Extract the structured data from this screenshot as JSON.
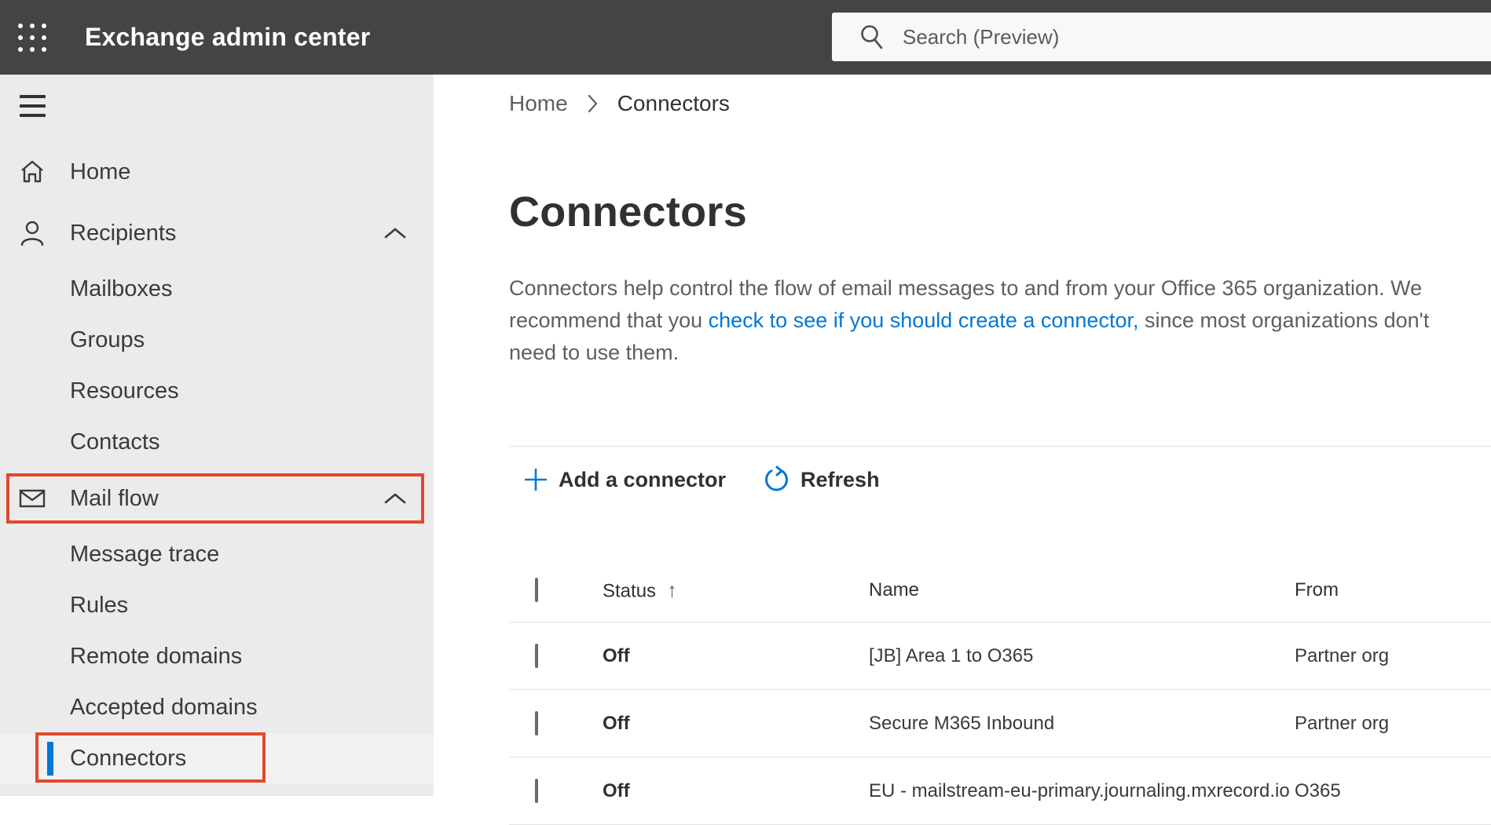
{
  "topbar": {
    "title": "Exchange admin center",
    "search_placeholder": "Search (Preview)",
    "icons": {
      "app_launcher": "waffle-icon",
      "search": "magnifier-icon"
    }
  },
  "sidebar": {
    "hamburger_icon": "hamburger-menu-icon",
    "items": [
      {
        "label": "Home",
        "icon": "home-icon",
        "level": 1
      },
      {
        "label": "Recipients",
        "icon": "person-icon",
        "level": 1,
        "expanded": true
      },
      {
        "label": "Mailboxes",
        "level": 2
      },
      {
        "label": "Groups",
        "level": 2
      },
      {
        "label": "Resources",
        "level": 2
      },
      {
        "label": "Contacts",
        "level": 2
      },
      {
        "label": "Mail flow",
        "icon": "mail-envelope-icon",
        "level": 1,
        "expanded": true,
        "annotated": true
      },
      {
        "label": "Message trace",
        "level": 2
      },
      {
        "label": "Rules",
        "level": 2
      },
      {
        "label": "Remote domains",
        "level": 2
      },
      {
        "label": "Accepted domains",
        "level": 2
      },
      {
        "label": "Connectors",
        "level": 2,
        "selected": true,
        "annotated": true
      }
    ]
  },
  "breadcrumb": {
    "home": "Home",
    "current": "Connectors"
  },
  "page": {
    "title": "Connectors",
    "description_before_link": "Connectors help control the flow of email messages to and from your Office 365 organization. We recommend that you ",
    "description_link": "check to see if you should create a connector,",
    "description_after_link": " since most organizations don't need to use them."
  },
  "toolbar": {
    "add_label": "Add a connector",
    "add_icon": "plus-icon",
    "refresh_label": "Refresh",
    "refresh_icon": "refresh-icon"
  },
  "table": {
    "headers": {
      "status": "Status",
      "name": "Name",
      "from": "From"
    },
    "sort_indicator": "↑",
    "rows": [
      {
        "status": "Off",
        "name": "[JB] Area 1 to O365",
        "from": "Partner org"
      },
      {
        "status": "Off",
        "name": "Secure M365 Inbound",
        "from": "Partner org"
      },
      {
        "status": "Off",
        "name": "EU - mailstream-eu-primary.journaling.mxrecord.io",
        "from": "O365"
      }
    ]
  },
  "colors": {
    "topbar_bg": "#464442",
    "sidebar_bg": "#ebebeb",
    "accent_blue": "#0078d4",
    "annotation_red": "#e2492b",
    "text_dark": "#323130",
    "text_gray": "#605e5c"
  }
}
